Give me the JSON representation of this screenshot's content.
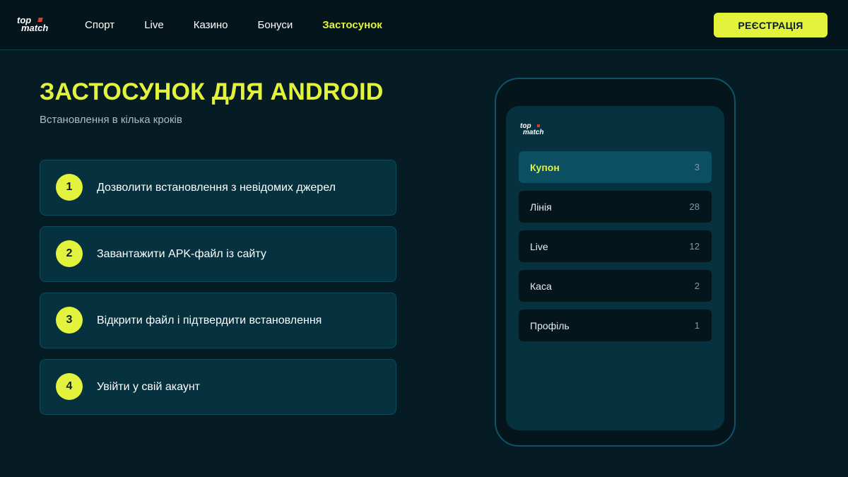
{
  "brand": {
    "logo_top": "top",
    "logo_bottom": "match",
    "accent_color": "#e3f23c",
    "logo_mark_color": "#e03a2a"
  },
  "header": {
    "nav": [
      {
        "label": "Спорт"
      },
      {
        "label": "Live"
      },
      {
        "label": "Казино"
      },
      {
        "label": "Бонуси"
      },
      {
        "label": "Застосунок",
        "active": true
      }
    ],
    "register_label": "РЕЄСТРАЦІЯ"
  },
  "main": {
    "title": "ЗАСТОСУНОК ДЛЯ ANDROID",
    "subtitle": "Встановлення в кілька кроків",
    "steps": [
      {
        "number": "1",
        "text": "Дозволити встановлення з невідомих джерел"
      },
      {
        "number": "2",
        "text": "Завантажити APK-файл із сайту"
      },
      {
        "number": "3",
        "text": "Відкрити файл і підтвердити встановлення"
      },
      {
        "number": "4",
        "text": "Увійти у свій акаунт"
      }
    ]
  },
  "phone": {
    "logo_top": "top",
    "logo_bottom": "match",
    "menu": [
      {
        "label": "Купон",
        "count": "3",
        "active": true
      },
      {
        "label": "Лінія",
        "count": "28"
      },
      {
        "label": "Live",
        "count": "12"
      },
      {
        "label": "Каса",
        "count": "2"
      },
      {
        "label": "Профіль",
        "count": "1"
      }
    ]
  }
}
